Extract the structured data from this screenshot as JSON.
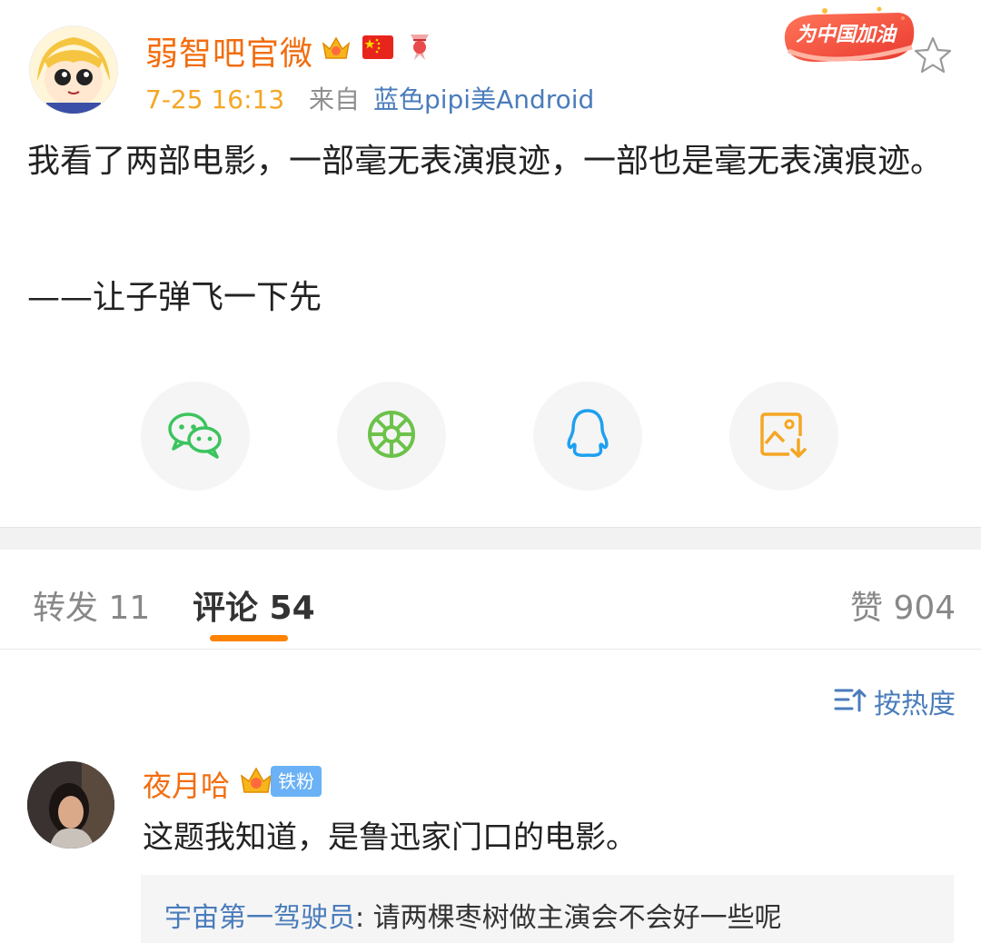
{
  "post": {
    "author": "弱智吧官微",
    "time": "7-25 16:13",
    "from_label": "来自",
    "device": "蓝色pipi美Android",
    "promo_text": "为中国加油",
    "text": "我看了两部电影，一部毫无表演痕迹，一部也是毫无表演痕迹。",
    "quote": "——让子弹飞一下先"
  },
  "share": {
    "items": [
      {
        "name": "wechat",
        "icon": "wechat-icon",
        "color": "#3cc45e"
      },
      {
        "name": "moments",
        "icon": "moments-icon",
        "color": "#6cc24a"
      },
      {
        "name": "qq",
        "icon": "qq-icon",
        "color": "#1ea0f0"
      },
      {
        "name": "save-image",
        "icon": "save-image-icon",
        "color": "#f5a623"
      }
    ]
  },
  "tabs": {
    "repost": "转发 11",
    "comment": "评论 54",
    "like": "赞 904"
  },
  "sort": {
    "label": "按热度"
  },
  "comment": {
    "user": "夜月哈",
    "fan_tag": "铁粉",
    "text": "这题我知道，是鲁迅家门口的电影。",
    "reply_user": "宇宙第一驾驶员",
    "reply_text": ": 请两棵枣树做主演会不会好一些呢"
  },
  "colors": {
    "accent": "#ff8200",
    "name": "#f26d0f",
    "link": "#4a7cbb"
  }
}
